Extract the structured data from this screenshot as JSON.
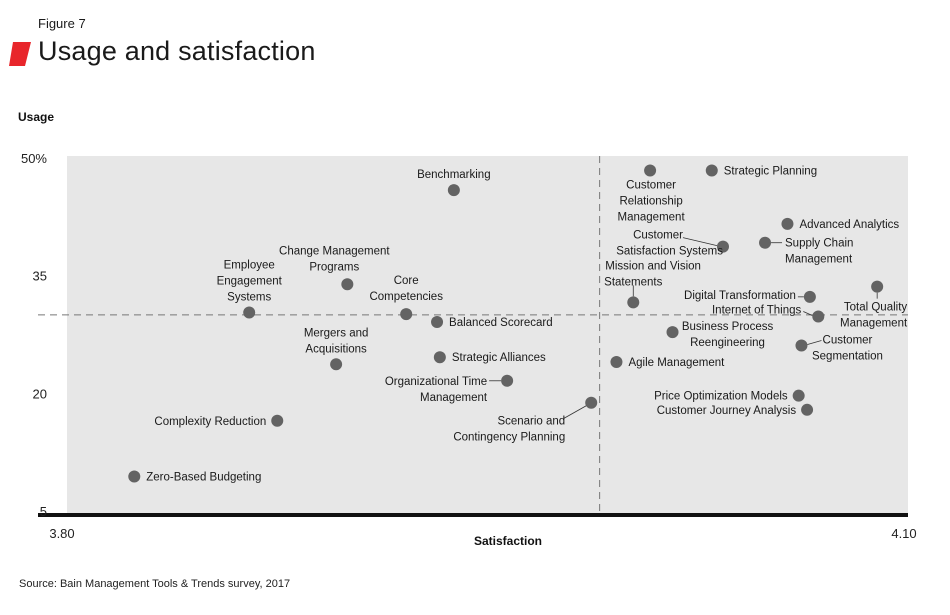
{
  "figure_label": "Figure 7",
  "title": "Usage and satisfaction",
  "source": "Source: Bain Management Tools & Trends survey, 2017",
  "colors": {
    "accent": "#e8262b",
    "plot_bg": "#e7e7e7",
    "point": "#636363",
    "axis": "#111111",
    "guide": "#777777"
  },
  "chart_data": {
    "type": "scatter",
    "title": "Usage and satisfaction",
    "xlabel": "Satisfaction",
    "ylabel": "Usage",
    "xlim": [
      3.8,
      4.1
    ],
    "ylim": [
      5,
      50
    ],
    "x_ticks": [
      {
        "value": 3.8,
        "label": "3.80"
      },
      {
        "value": 4.1,
        "label": "4.10"
      }
    ],
    "y_ticks": [
      {
        "value": 50,
        "label": "50%"
      },
      {
        "value": 35,
        "label": "35"
      },
      {
        "value": 20,
        "label": "20"
      },
      {
        "value": 5,
        "label": "5"
      }
    ],
    "reference_lines": {
      "x": 3.99,
      "y": 30
    },
    "grid": false,
    "legend": "none",
    "points": [
      {
        "name": "Benchmarking",
        "x": 3.938,
        "y": 45.9,
        "label_lines": [
          "Benchmarking"
        ],
        "label_pos": "above"
      },
      {
        "name": "Customer Relationship Management",
        "x": 4.008,
        "y": 48.4,
        "label_lines": [
          "Customer",
          "Relationship",
          "Management"
        ],
        "label_pos": "below"
      },
      {
        "name": "Strategic Planning",
        "x": 4.03,
        "y": 48.4,
        "label_lines": [
          "Strategic Planning"
        ],
        "label_pos": "right"
      },
      {
        "name": "Advanced Analytics",
        "x": 4.057,
        "y": 41.6,
        "label_lines": [
          "Advanced Analytics"
        ],
        "label_pos": "right"
      },
      {
        "name": "Supply Chain Management",
        "x": 4.049,
        "y": 39.2,
        "label_lines": [
          "Supply Chain",
          "Management"
        ],
        "label_pos": "right-leader"
      },
      {
        "name": "Customer Satisfaction Systems",
        "x": 4.034,
        "y": 38.7,
        "label_lines": [
          "Customer",
          "Satisfaction Systems"
        ],
        "label_pos": "left-leader"
      },
      {
        "name": "Mission and Vision Statements",
        "x": 4.002,
        "y": 31.6,
        "label_lines": [
          "Mission and Vision",
          "Statements"
        ],
        "label_pos": "above-leader"
      },
      {
        "name": "Total Quality Management",
        "x": 4.089,
        "y": 33.6,
        "label_lines": [
          "Total Quality",
          "Management"
        ],
        "label_pos": "below-leader"
      },
      {
        "name": "Digital Transformation",
        "x": 4.065,
        "y": 32.3,
        "label_lines": [
          "Digital Transformation"
        ],
        "label_pos": "left-leader"
      },
      {
        "name": "Internet of Things",
        "x": 4.068,
        "y": 29.8,
        "label_lines": [
          "Internet of Things"
        ],
        "label_pos": "left-leader"
      },
      {
        "name": "Business Process Reengineering",
        "x": 4.016,
        "y": 27.8,
        "label_lines": [
          "Business Process",
          "Reengineering"
        ],
        "label_pos": "right"
      },
      {
        "name": "Customer Segmentation",
        "x": 4.062,
        "y": 26.1,
        "label_lines": [
          "Customer",
          "Segmentation"
        ],
        "label_pos": "right-leader"
      },
      {
        "name": "Agile Management",
        "x": 3.996,
        "y": 24.0,
        "label_lines": [
          "Agile Management"
        ],
        "label_pos": "right"
      },
      {
        "name": "Price Optimization Models",
        "x": 4.061,
        "y": 19.7,
        "label_lines": [
          "Price Optimization Models"
        ],
        "label_pos": "left"
      },
      {
        "name": "Customer Journey Analysis",
        "x": 4.064,
        "y": 17.9,
        "label_lines": [
          "Customer Journey Analysis"
        ],
        "label_pos": "left"
      },
      {
        "name": "Employee Engagement Systems",
        "x": 3.865,
        "y": 30.3,
        "label_lines": [
          "Employee",
          "Engagement",
          "Systems"
        ],
        "label_pos": "above"
      },
      {
        "name": "Change Management Programs",
        "x": 3.9,
        "y": 33.9,
        "label_lines": [
          "Change Management",
          "Programs"
        ],
        "label_pos": "above"
      },
      {
        "name": "Core Competencies",
        "x": 3.921,
        "y": 30.1,
        "label_lines": [
          "Core",
          "Competencies"
        ],
        "label_pos": "above"
      },
      {
        "name": "Balanced Scorecard",
        "x": 3.932,
        "y": 29.1,
        "label_lines": [
          "Balanced Scorecard"
        ],
        "label_pos": "right"
      },
      {
        "name": "Mergers and Acquisitions",
        "x": 3.896,
        "y": 23.7,
        "label_lines": [
          "Mergers and",
          "Acquisitions"
        ],
        "label_pos": "above"
      },
      {
        "name": "Strategic Alliances",
        "x": 3.933,
        "y": 24.6,
        "label_lines": [
          "Strategic Alliances"
        ],
        "label_pos": "right"
      },
      {
        "name": "Organizational Time Management",
        "x": 3.957,
        "y": 21.6,
        "label_lines": [
          "Organizational Time",
          "Management"
        ],
        "label_pos": "left-leader"
      },
      {
        "name": "Scenario and Contingency Planning",
        "x": 3.987,
        "y": 18.8,
        "label_lines": [
          "Scenario and",
          "Contingency Planning"
        ],
        "label_pos": "below-left-leader"
      },
      {
        "name": "Complexity Reduction",
        "x": 3.875,
        "y": 16.5,
        "label_lines": [
          "Complexity Reduction"
        ],
        "label_pos": "left"
      },
      {
        "name": "Zero-Based Budgeting",
        "x": 3.824,
        "y": 9.4,
        "label_lines": [
          "Zero-Based Budgeting"
        ],
        "label_pos": "right"
      }
    ]
  }
}
